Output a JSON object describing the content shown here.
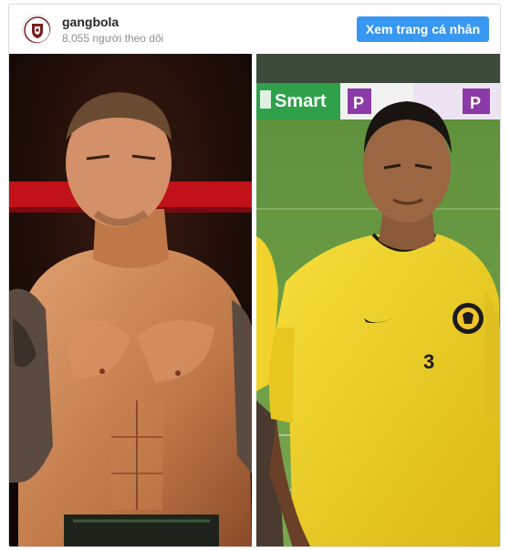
{
  "profile": {
    "username": "gangbola",
    "followers": "8,055 người theo dõi",
    "view_profile_label": "Xem trang cá nhân"
  },
  "photo": {
    "left_panel": {
      "banner_text": "",
      "colors": {
        "background": "#1a0d08",
        "skin": "#c8845a",
        "banner": "#c1121a"
      }
    },
    "right_panel": {
      "sponsor_board_text": "Smart",
      "board_text_2": "P",
      "board_text_3": "P",
      "jersey_number": "3",
      "colors": {
        "pitch": "#6f9a45",
        "jersey": "#f2d21e",
        "board_green": "#2fa14a",
        "board_purple": "#8b3aa8"
      }
    }
  },
  "theme": {
    "button_blue": "#3897f0",
    "username_color": "#262626",
    "muted_text": "#8e8e8e"
  }
}
